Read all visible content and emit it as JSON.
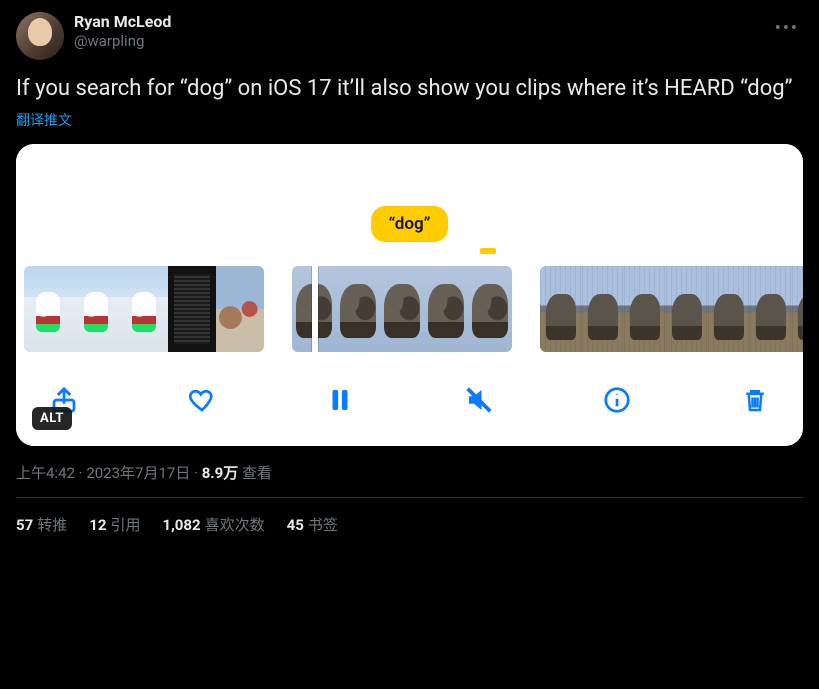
{
  "author": {
    "display_name": "Ryan McLeod",
    "handle": "@warpling"
  },
  "tweet_text": "If you search for “dog” on iOS 17 it’ll also show you clips where it’s HEARD “dog”",
  "translate_label": "翻译推文",
  "media": {
    "search_pill": "“dog”",
    "alt_badge": "ALT",
    "controls": {
      "share": "share-icon",
      "like": "heart-icon",
      "pause": "pause-icon",
      "mute": "mute-icon",
      "info": "info-icon",
      "trash": "trash-icon"
    }
  },
  "meta": {
    "time": "上午4:42",
    "sep1": " · ",
    "date": "2023年7月17日",
    "sep2": " · ",
    "views_num": "8.9万",
    "views_label": " 查看"
  },
  "stats": {
    "retweets_num": "57",
    "retweets_label": "转推",
    "quotes_num": "12",
    "quotes_label": "引用",
    "likes_num": "1,082",
    "likes_label": "喜欢次数",
    "bookmarks_num": "45",
    "bookmarks_label": "书签"
  }
}
